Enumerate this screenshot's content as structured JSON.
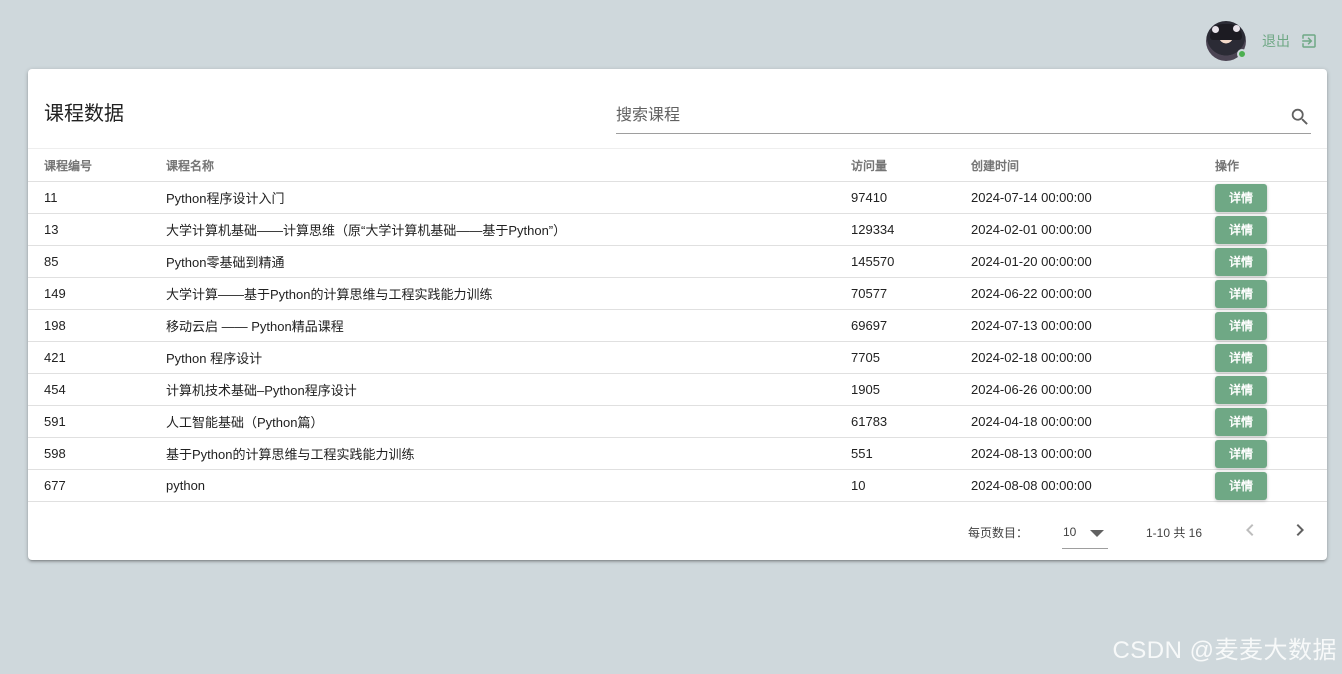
{
  "header": {
    "logout_label": "退出",
    "avatar_icon": "user-avatar",
    "logout_icon": "exit-to-app-icon"
  },
  "card": {
    "title": "课程数据",
    "search_placeholder": "搜索课程",
    "search_icon": "search-icon"
  },
  "table": {
    "columns": [
      "课程编号",
      "课程名称",
      "访问量",
      "创建时间",
      "操作"
    ],
    "action_label": "详情",
    "rows": [
      {
        "id": "11",
        "name": "Python程序设计入门",
        "visits": "97410",
        "created": "2024-07-14 00:00:00"
      },
      {
        "id": "13",
        "name": "大学计算机基础——计算思维（原“大学计算机基础——基于Python”）",
        "visits": "129334",
        "created": "2024-02-01 00:00:00"
      },
      {
        "id": "85",
        "name": "Python零基础到精通",
        "visits": "145570",
        "created": "2024-01-20 00:00:00"
      },
      {
        "id": "149",
        "name": "大学计算——基于Python的计算思维与工程实践能力训练",
        "visits": "70577",
        "created": "2024-06-22 00:00:00"
      },
      {
        "id": "198",
        "name": "移动云启 —— Python精品课程",
        "visits": "69697",
        "created": "2024-07-13 00:00:00"
      },
      {
        "id": "421",
        "name": "Python 程序设计",
        "visits": "7705",
        "created": "2024-02-18 00:00:00"
      },
      {
        "id": "454",
        "name": "计算机技术基础–Python程序设计",
        "visits": "1905",
        "created": "2024-06-26 00:00:00"
      },
      {
        "id": "591",
        "name": "人工智能基础（Python篇）",
        "visits": "61783",
        "created": "2024-04-18 00:00:00"
      },
      {
        "id": "598",
        "name": "基于Python的计算思维与工程实践能力训练",
        "visits": "551",
        "created": "2024-08-13 00:00:00"
      },
      {
        "id": "677",
        "name": "python",
        "visits": "10",
        "created": "2024-08-08 00:00:00"
      }
    ]
  },
  "pagination": {
    "rows_per_page_label": "每页数目：",
    "rows_per_page_value": "10",
    "range_text": "1-10 共 16",
    "prev_icon": "chevron-left-icon",
    "next_icon": "chevron-right-icon"
  },
  "watermark": "CSDN @麦麦大数据",
  "colors": {
    "background": "#cfd8dc",
    "accent": "#6fa885",
    "status_online": "#4caf50"
  }
}
